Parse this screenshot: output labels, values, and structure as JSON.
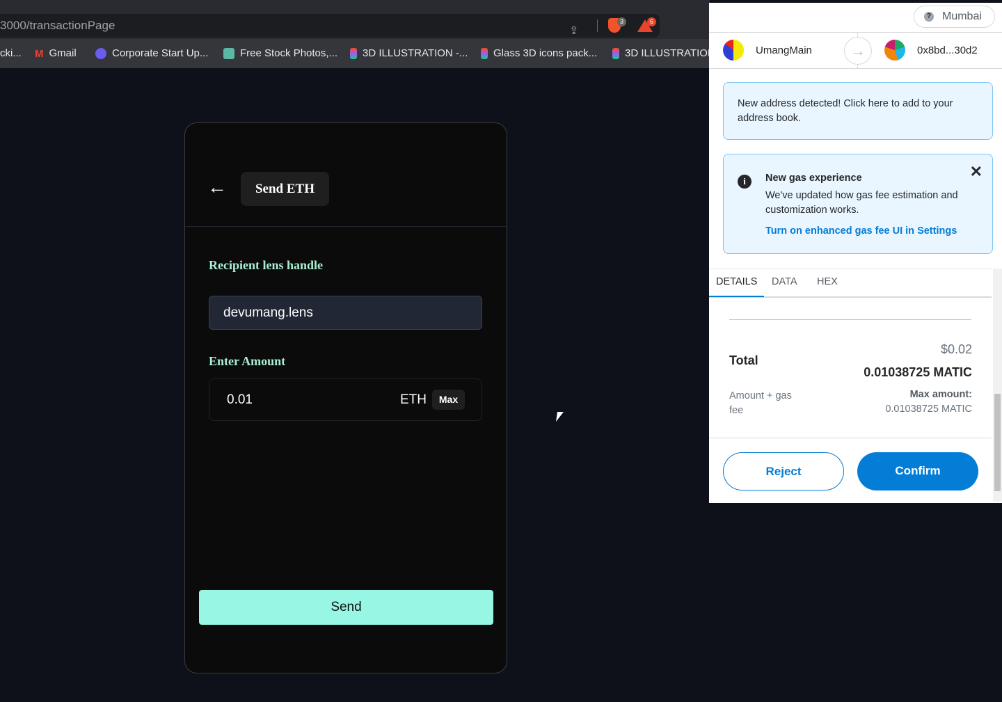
{
  "browser": {
    "url": "3000/transactionPage",
    "brave_badge": "3",
    "rewards_badge": "6",
    "bookmarks": [
      {
        "label": "cki..."
      },
      {
        "label": "Gmail"
      },
      {
        "label": "Corporate Start Up..."
      },
      {
        "label": "Free Stock Photos,..."
      },
      {
        "label": "3D ILLUSTRATION -..."
      },
      {
        "label": "Glass 3D icons pack..."
      },
      {
        "label": "3D ILLUSTRATION"
      }
    ]
  },
  "app": {
    "back_icon": "←",
    "title": "Send ETH",
    "recipient_label": "Recipient lens handle",
    "recipient_value": "devumang.lens",
    "amount_label": "Enter Amount",
    "amount_value": "0.01",
    "amount_unit": "ETH",
    "max_label": "Max",
    "send_label": "Send",
    "accent": "#97f7e4"
  },
  "metamask": {
    "network": "Mumbai",
    "network_icon": "?",
    "from_account": "UmangMain",
    "to_account": "0x8bd...30d2",
    "address_notice": "New address detected! Click here to add to your address book.",
    "gas_notice": {
      "title": "New gas experience",
      "body": "We've updated how gas fee estimation and customization works.",
      "link": "Turn on enhanced gas fee UI in Settings"
    },
    "tabs": [
      {
        "label": "DETAILS"
      },
      {
        "label": "DATA"
      },
      {
        "label": "HEX"
      }
    ],
    "total_label": "Total",
    "total_fiat": "$0.02",
    "total_native": "0.01038725 MATIC",
    "sub_label": "Amount + gas fee",
    "max_amount_label": "Max amount:",
    "max_amount_value": "0.01038725 MATIC",
    "reject_label": "Reject",
    "confirm_label": "Confirm",
    "primary": "#037dd6"
  }
}
